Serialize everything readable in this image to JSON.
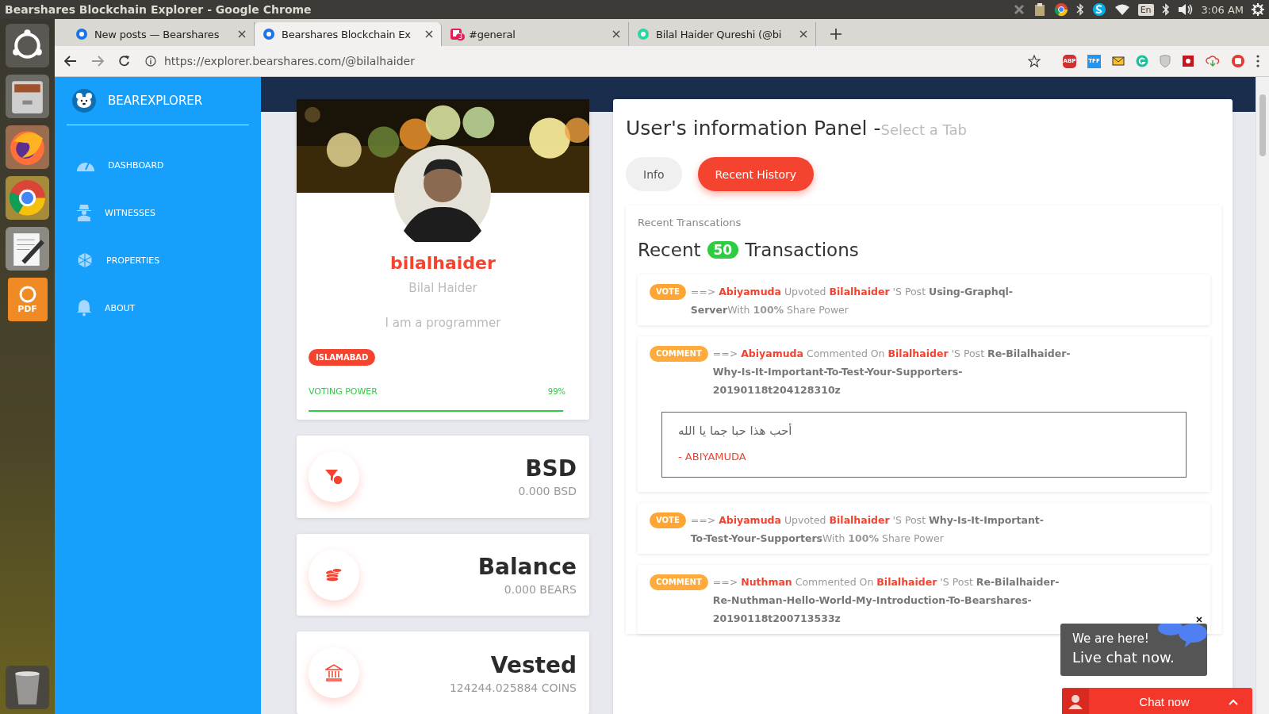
{
  "system_bar": {
    "title": "Bearshares Blockchain Explorer - Google Chrome",
    "keyboard": "En",
    "clock": "3:06 AM"
  },
  "launcher": [
    {
      "kind": "dash"
    },
    {
      "kind": "cabinet"
    },
    {
      "kind": "fox"
    },
    {
      "kind": "wheel"
    },
    {
      "kind": "editor"
    },
    {
      "kind": "pdf",
      "label": "PDF"
    },
    {
      "kind": "trash"
    }
  ],
  "browser": {
    "tabs": [
      {
        "title": "New posts — Bearshares",
        "selected": false
      },
      {
        "title": "Bearshares Blockchain Ex",
        "selected": true
      },
      {
        "title": "#general",
        "selected": false,
        "badge": "3"
      },
      {
        "title": "Bilal Haider Qureshi (@bi",
        "selected": false
      }
    ],
    "url": "https://explorer.bearshares.com/@bilalhaider",
    "extensions": [
      {
        "kind": "stop",
        "label": "ABP"
      },
      {
        "kind": "square",
        "label": "TFF"
      },
      {
        "kind": "mail"
      },
      {
        "kind": "ring"
      },
      {
        "kind": "shield"
      },
      {
        "kind": "red"
      },
      {
        "kind": "cloud"
      }
    ]
  },
  "sidebar": {
    "brand": "BEAREXPLORER",
    "items": [
      {
        "kind": "gauge",
        "label": "DASHBOARD"
      },
      {
        "kind": "spy",
        "label": "WITNESSES"
      },
      {
        "kind": "poly",
        "label": "PROPERTIES"
      },
      {
        "kind": "bell",
        "label": "ABOUT"
      }
    ]
  },
  "profile": {
    "username": "bilalhaider",
    "name": "Bilal Haider",
    "about": "I am a programmer",
    "location": "ISLAMABAD",
    "voting_label": "VOTING POWER",
    "voting_reading": "99%",
    "level": 0.99
  },
  "stats": [
    {
      "kind": "funnel",
      "title": "BSD",
      "value": "0.000 BSD"
    },
    {
      "kind": "coins",
      "title": "Balance",
      "value": "0.000 BEARS"
    },
    {
      "kind": "bank",
      "title": "Vested",
      "value": "124244.025884 COINS"
    }
  ],
  "panel": {
    "title": "User's information Panel -",
    "hint": "Select a Tab",
    "tabs": [
      {
        "label": "Info",
        "selected": false
      },
      {
        "label": "Recent History",
        "selected": true
      }
    ],
    "card_title": "Recent Transcations",
    "heading_before": "Recent",
    "count": "50",
    "heading_after": "Transactions",
    "transactions": [
      {
        "kind": "vote",
        "badge": "VOTE",
        "arrow": "==>",
        "actor": "Abiyamuda",
        "action": "Upvoted",
        "target": "Bilalhaider",
        "middle": "'S Post",
        "post": "Using-Graphql-Server",
        "tail": "With **100%** Share Power"
      },
      {
        "kind": "comment",
        "badge": "COMMENT",
        "arrow": "==>",
        "actor": "Abiyamuda",
        "action": "Commented On",
        "target": "Bilalhaider",
        "middle": "'S Post",
        "post": "Re-Bilalhaider-Why-Is-It-Important-To-Test-Your-Supporters-20190118t204128310z",
        "quote": {
          "text": "أحب هذا حبا جما يا الله",
          "author": "- ABIYAMUDA"
        }
      },
      {
        "kind": "vote",
        "badge": "VOTE",
        "arrow": "==>",
        "actor": "Abiyamuda",
        "action": "Upvoted",
        "target": "Bilalhaider",
        "middle": "'S Post",
        "post": "Why-Is-It-Important-To-Test-Your-Supporters",
        "tail": "With **100%** Share Power"
      },
      {
        "kind": "comment",
        "badge": "COMMENT",
        "arrow": "==>",
        "actor": "Nuthman",
        "action": "Commented On",
        "target": "Bilalhaider",
        "middle": "'S Post",
        "post": "Re-Bilalhaider-Re-Nuthman-Hello-World-My-Introduction-To-Bearshares-20190118t200713533z"
      }
    ]
  },
  "chat": {
    "line_1": "We are here!",
    "line_2": "Live chat now.",
    "button": "Chat now"
  }
}
